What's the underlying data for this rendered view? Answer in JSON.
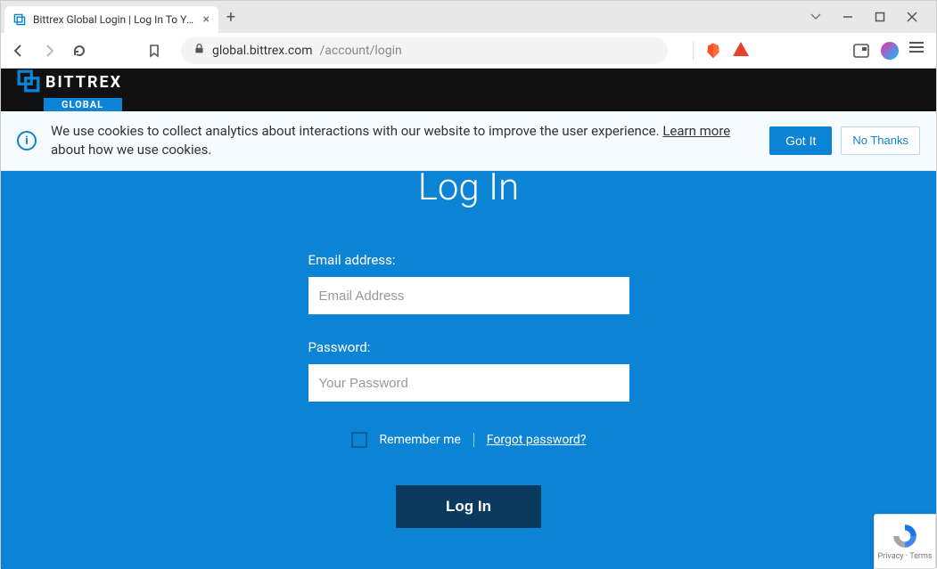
{
  "browser": {
    "tab_title": "Bittrex Global Login | Log In To Your Account",
    "url_host": "global.bittrex.com",
    "url_path": "/account/login"
  },
  "site": {
    "brand": "BITTREX",
    "brand_badge": "GLOBAL"
  },
  "cookie": {
    "text_before": "We use cookies to collect analytics about interactions with our website to improve the user experience. ",
    "learn_more": "Learn more",
    "text_after": " about how we use cookies.",
    "got_it": "Got It",
    "no_thanks": "No Thanks"
  },
  "login": {
    "title": "Log In",
    "email_label": "Email address:",
    "email_placeholder": "Email Address",
    "password_label": "Password:",
    "password_placeholder": "Your Password",
    "remember": "Remember me",
    "forgot": "Forgot password?",
    "button": "Log In"
  },
  "recaptcha": {
    "footer": "Privacy · Terms"
  }
}
